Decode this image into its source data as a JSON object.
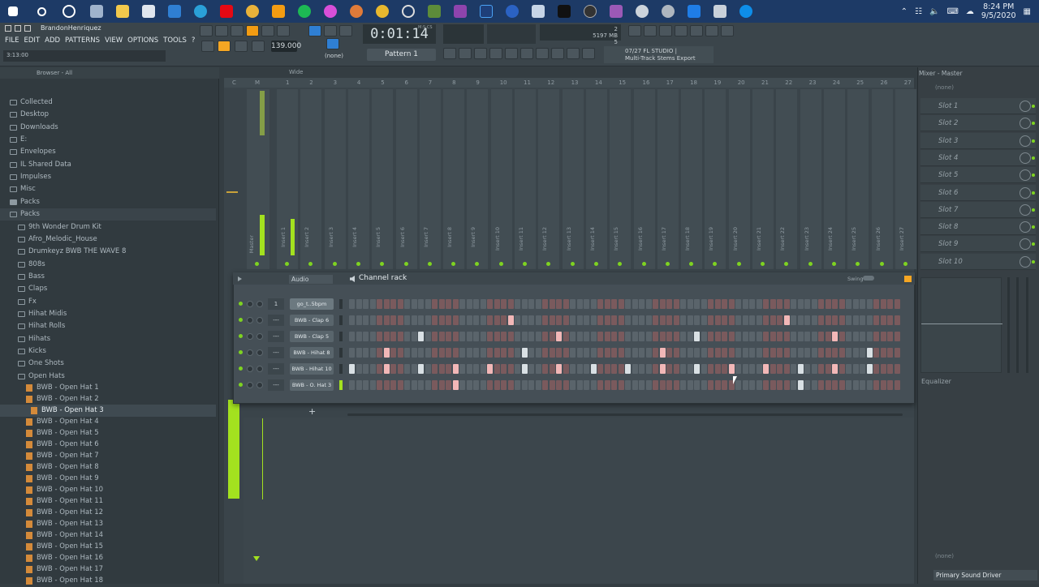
{
  "taskbar": {
    "clock_time": "8:24 PM",
    "clock_date": "9/5/2020"
  },
  "titlebar": {
    "user": "BrandonHenriquez"
  },
  "menu": [
    "FILE",
    "EDIT",
    "ADD",
    "PATTERNS",
    "VIEW",
    "OPTIONS",
    "TOOLS",
    "?"
  ],
  "hint_time": "3:13:00",
  "transport": {
    "tempo": "139.000",
    "time": "0:01:14",
    "time_unit": "M:S:CS",
    "pattern": "Pattern 1",
    "channel_none": "(none)"
  },
  "cpu": {
    "line1": "2",
    "line2": "5197 MB",
    "line3": "5"
  },
  "news": {
    "line1": "07/27  FL STUDIO |",
    "line2": "Multi-Track Stems Export"
  },
  "browser": {
    "header": "Browser - All",
    "items": [
      {
        "label": "Collected",
        "kind": "folder",
        "indent": 0
      },
      {
        "label": "Desktop",
        "kind": "folder",
        "indent": 0
      },
      {
        "label": "Downloads",
        "kind": "folder",
        "indent": 0
      },
      {
        "label": "E:",
        "kind": "folder",
        "indent": 0
      },
      {
        "label": "Envelopes",
        "kind": "folder",
        "indent": 0
      },
      {
        "label": "IL Shared Data",
        "kind": "folder",
        "indent": 0
      },
      {
        "label": "Impulses",
        "kind": "folder",
        "indent": 0
      },
      {
        "label": "Misc",
        "kind": "folder",
        "indent": 0
      },
      {
        "label": "Packs",
        "kind": "folder-filled",
        "indent": 0
      },
      {
        "label": "Packs",
        "kind": "folder",
        "indent": 0
      },
      {
        "label": "9th Wonder Drum Kit",
        "kind": "folder",
        "indent": 1
      },
      {
        "label": "Afro_Melodic_House",
        "kind": "folder",
        "indent": 1
      },
      {
        "label": "Drumkeyz BWB THE WAVE 8",
        "kind": "folder",
        "indent": 1
      },
      {
        "label": "808s",
        "kind": "folder",
        "indent": 2
      },
      {
        "label": "Bass",
        "kind": "folder",
        "indent": 2
      },
      {
        "label": "Claps",
        "kind": "folder",
        "indent": 2
      },
      {
        "label": "Fx",
        "kind": "folder",
        "indent": 2
      },
      {
        "label": "Hihat Midis",
        "kind": "folder",
        "indent": 2
      },
      {
        "label": "Hihat Rolls",
        "kind": "folder",
        "indent": 2
      },
      {
        "label": "Hihats",
        "kind": "folder",
        "indent": 2
      },
      {
        "label": "Kicks",
        "kind": "folder",
        "indent": 2
      },
      {
        "label": "One Shots",
        "kind": "folder",
        "indent": 2
      },
      {
        "label": "Open Hats",
        "kind": "folder",
        "indent": 2
      },
      {
        "label": "BWB - Open Hat 1",
        "kind": "file",
        "indent": 3
      },
      {
        "label": "BWB - Open Hat 2",
        "kind": "file",
        "indent": 3
      },
      {
        "label": "BWB - Open Hat 3",
        "kind": "file-selected",
        "indent": 4
      },
      {
        "label": "BWB - Open Hat 4",
        "kind": "file",
        "indent": 3
      },
      {
        "label": "BWB - Open Hat 5",
        "kind": "file",
        "indent": 3
      },
      {
        "label": "BWB - Open Hat 6",
        "kind": "file",
        "indent": 3
      },
      {
        "label": "BWB - Open Hat 7",
        "kind": "file",
        "indent": 3
      },
      {
        "label": "BWB - Open Hat 8",
        "kind": "file",
        "indent": 3
      },
      {
        "label": "BWB - Open Hat 9",
        "kind": "file",
        "indent": 3
      },
      {
        "label": "BWB - Open Hat 10",
        "kind": "file",
        "indent": 3
      },
      {
        "label": "BWB - Open Hat 11",
        "kind": "file",
        "indent": 3
      },
      {
        "label": "BWB - Open Hat 12",
        "kind": "file",
        "indent": 3
      },
      {
        "label": "BWB - Open Hat 13",
        "kind": "file",
        "indent": 3
      },
      {
        "label": "BWB - Open Hat 14",
        "kind": "file",
        "indent": 3
      },
      {
        "label": "BWB - Open Hat 15",
        "kind": "file",
        "indent": 3
      },
      {
        "label": "BWB - Open Hat 16",
        "kind": "file",
        "indent": 3
      },
      {
        "label": "BWB - Open Hat 17",
        "kind": "file",
        "indent": 3
      },
      {
        "label": "BWB - Open Hat 18",
        "kind": "file",
        "indent": 3
      }
    ]
  },
  "mixer": {
    "header": "Wide",
    "master_label": "Master",
    "ruler": [
      "C",
      "M",
      "1",
      "2",
      "3",
      "4",
      "5",
      "6",
      "7",
      "8",
      "9",
      "10",
      "11",
      "12",
      "13",
      "14",
      "15",
      "16",
      "17",
      "18",
      "19",
      "20",
      "21",
      "22",
      "23",
      "24",
      "25",
      "26",
      "27"
    ],
    "inserts": [
      "Insert 1",
      "Insert 2",
      "Insert 3",
      "Insert 4",
      "Insert 5",
      "Insert 6",
      "Insert 7",
      "Insert 8",
      "Insert 9",
      "Insert 10",
      "Insert 11",
      "Insert 12",
      "Insert 13",
      "Insert 14",
      "Insert 15",
      "Insert 16",
      "Insert 17",
      "Insert 18",
      "Insert 19",
      "Insert 20",
      "Insert 21",
      "Insert 22",
      "Insert 23",
      "Insert 24",
      "Insert 25",
      "Insert 26",
      "Insert 27"
    ]
  },
  "rack": {
    "audio_label": "Audio",
    "title": "Channel rack",
    "swing_label": "Swing",
    "channels": [
      {
        "mix": "1",
        "name": "go_t..5bpm",
        "steps": []
      },
      {
        "mix": "---",
        "name": "BWB - Clap 6",
        "steps": [
          23,
          63
        ]
      },
      {
        "mix": "---",
        "name": "BWB - Clap 5",
        "steps": [
          10,
          30,
          50,
          70
        ]
      },
      {
        "mix": "---",
        "name": "BWB - Hihat 8",
        "steps": [
          5,
          25,
          45,
          75
        ]
      },
      {
        "mix": "---",
        "name": "BWB - Hihat 10",
        "steps": [
          0,
          5,
          10,
          15,
          20,
          25,
          30,
          35,
          40,
          45,
          50,
          55,
          60,
          65,
          70,
          75
        ]
      },
      {
        "mix": "---",
        "name": "BWB - O. Hat 3",
        "steps": [
          15,
          65
        ]
      }
    ]
  },
  "fx": {
    "title": "Mixer - Master",
    "slot_none": "(none)",
    "slots": [
      "Slot 1",
      "Slot 2",
      "Slot 3",
      "Slot 4",
      "Slot 5",
      "Slot 6",
      "Slot 7",
      "Slot 8",
      "Slot 9",
      "Slot 10"
    ],
    "equalizer": "Equalizer",
    "bottom_none": "(none)",
    "driver": "Primary Sound Driver"
  }
}
